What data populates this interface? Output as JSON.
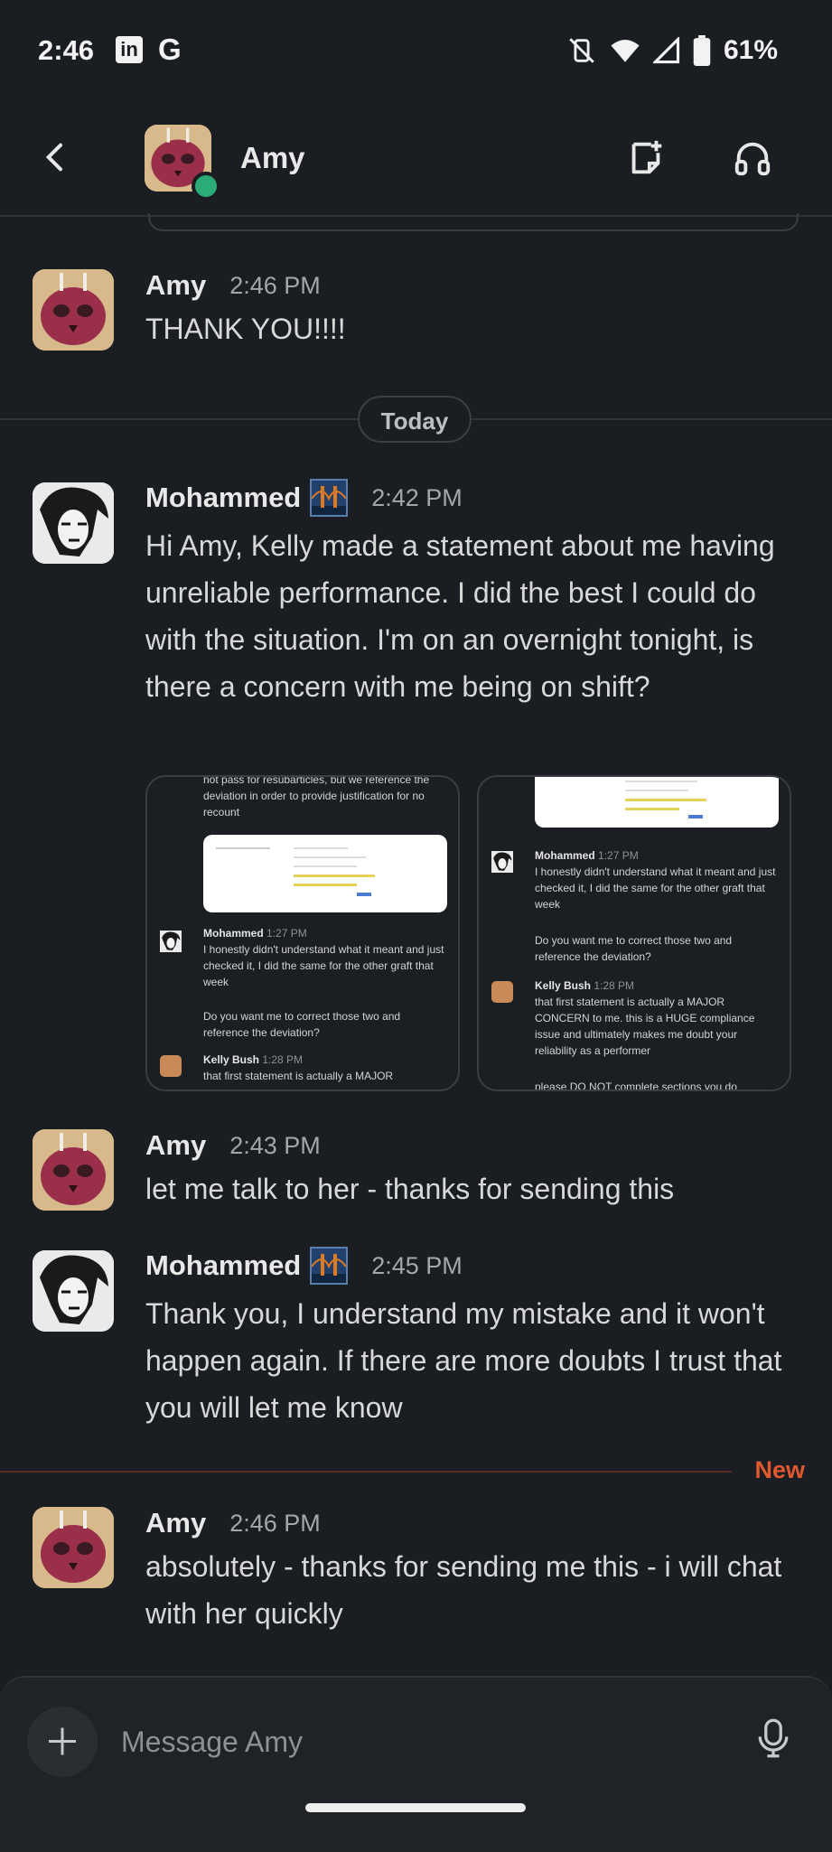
{
  "status_bar": {
    "time": "2:46",
    "app_icons": [
      "linkedin-icon",
      "google-icon"
    ],
    "battery": "61%"
  },
  "header": {
    "title": "Amy",
    "presence": "online"
  },
  "day_separator": "Today",
  "messages": [
    {
      "author": "Amy",
      "time": "2:46 PM",
      "text": "THANK YOU!!!!"
    },
    {
      "author": "Mohammed",
      "time": "2:42 PM",
      "text": "Hi Amy, Kelly made a statement about me having unreliable performance. I did the best I could do with the situation. I'm on an overnight tonight, is there a concern with me being on shift?"
    },
    {
      "author": "Amy",
      "time": "2:43 PM",
      "text": "let me talk to her - thanks for sending this"
    },
    {
      "author": "Mohammed",
      "time": "2:45 PM",
      "text": "Thank you, I understand my mistake and it won't happen again. If there are more doubts I trust that you will let me know"
    },
    {
      "author": "Amy",
      "time": "2:46 PM",
      "text": "absolutely - thanks for sending me this - i will chat with her quickly"
    }
  ],
  "attachments": [
    {
      "top_text": "not pass for resubarticles, but we reference the deviation in order to provide justification for no recount",
      "author1": "Mohammed",
      "time1": "1:27 PM",
      "text1": "I honestly didn't understand what it meant and just checked it, I did the same for the other graft that week",
      "text2": "Do you want me to correct those two and reference the deviation?",
      "author2": "Kelly Bush",
      "time2": "1:28 PM",
      "text3": "that first statement is actually a MAJOR"
    },
    {
      "author1": "Mohammed",
      "time1": "1:27 PM",
      "text1": "I honestly didn't understand what it meant and just checked it, I did the same for the other graft that week",
      "text2": "Do you want me to correct those two and reference the deviation?",
      "author2": "Kelly Bush",
      "time2": "1:28 PM",
      "text3": "that first statement is actually a MAJOR CONCERN to me. this is a HUGE compliance issue and ultimately makes me doubt your reliability as a performer",
      "text4": "please DO NOT complete sections you do"
    }
  ],
  "new_marker": "New",
  "composer": {
    "placeholder": "Message Amy"
  },
  "colors": {
    "background": "#1a1d21",
    "presence": "#2bac76",
    "new_marker": "#e0582f"
  }
}
